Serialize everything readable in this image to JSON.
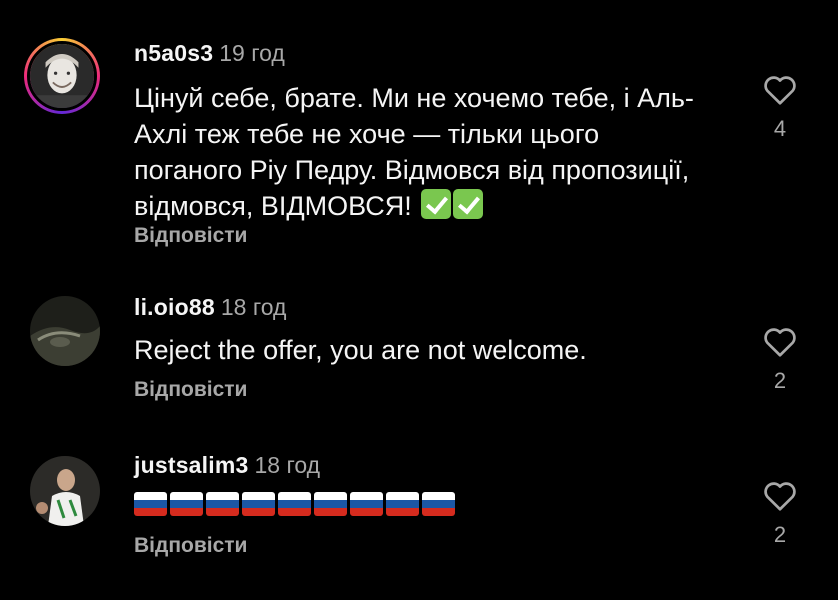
{
  "comments": [
    {
      "username": "n5a0s3",
      "time": "19 год",
      "text_before": "Цінуй себе, брате. Ми не хочемо тебе, і Аль-Ахлі теж тебе не хоче — тільки цього поганого Ріу Педру. Відмовся від пропозиції, відмовся, ВІДМОВСЯ!",
      "emoji": [
        "white-check-mark",
        "white-check-mark"
      ],
      "reply_label": "Відповісти",
      "likes": "4",
      "avatar_icon": "user-avatar-with-story-ring"
    },
    {
      "username": "li.oio88",
      "time": "18 год",
      "text": "Reject the offer, you are not welcome.",
      "reply_label": "Відповісти",
      "likes": "2",
      "avatar_icon": "user-avatar"
    },
    {
      "username": "justsalim3",
      "time": "18 год",
      "emoji": [
        "russia-flag",
        "russia-flag",
        "russia-flag",
        "russia-flag",
        "russia-flag",
        "russia-flag",
        "russia-flag",
        "russia-flag",
        "russia-flag"
      ],
      "reply_label": "Відповісти",
      "likes": "2",
      "avatar_icon": "user-avatar"
    }
  ],
  "colors": {
    "background": "#000000",
    "text_primary": "#f5f5f5",
    "text_secondary": "#a8a8a8",
    "check_green": "#7ac74f",
    "flag_white": "#ffffff",
    "flag_blue": "#1c57a5",
    "flag_red": "#d52b1e"
  }
}
